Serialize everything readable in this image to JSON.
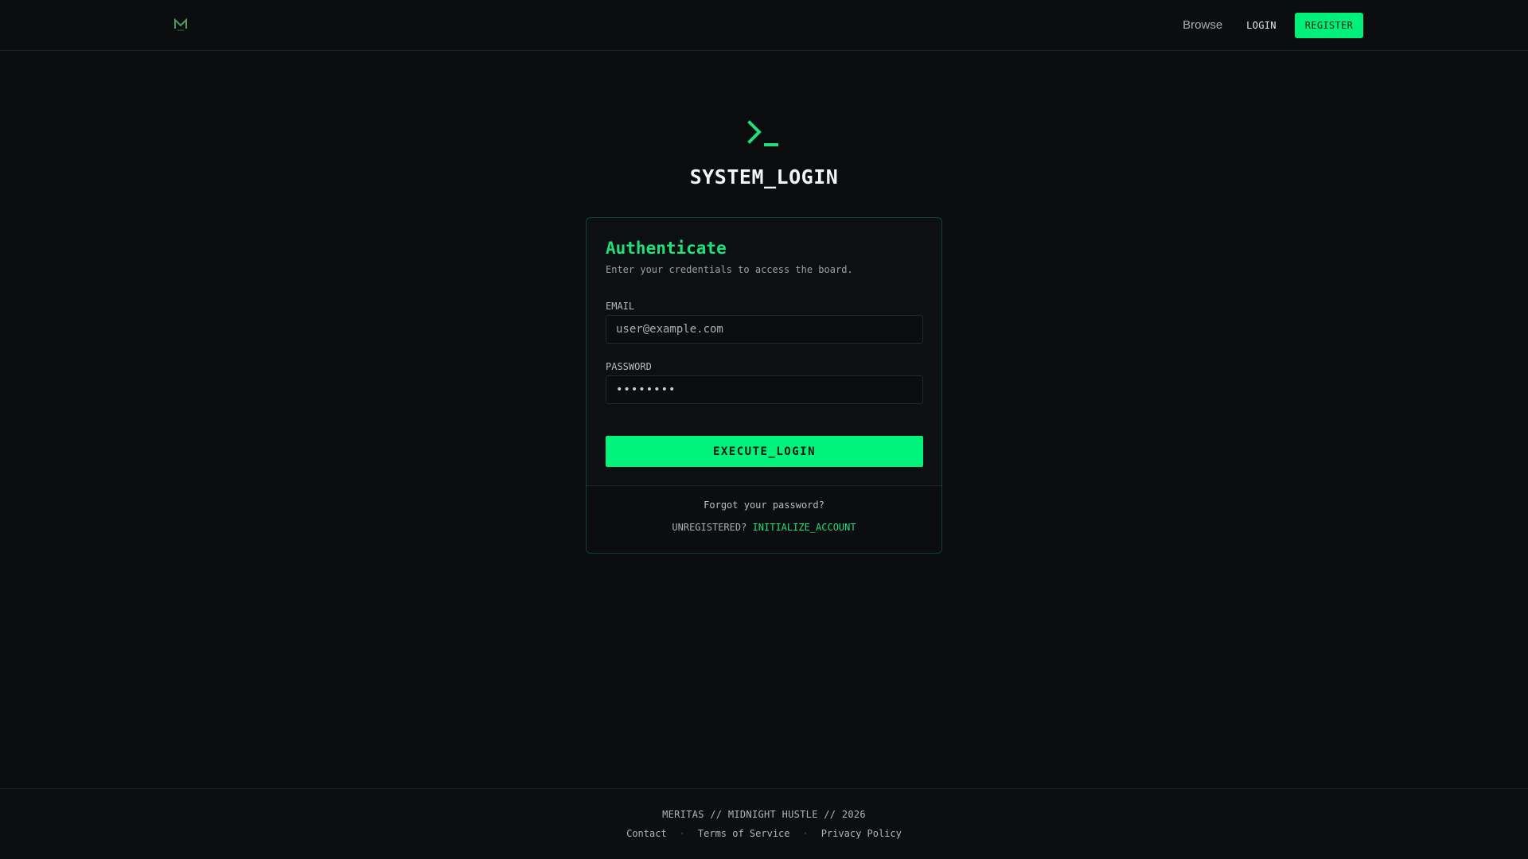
{
  "colors": {
    "accent": "#00f07a",
    "background": "#0a0c0e",
    "heading_accent": "#1fe07a"
  },
  "navbar": {
    "logo_icon": "m-logo-icon",
    "browse_label": "Browse",
    "login_label": "LOGIN",
    "register_label": "REGISTER"
  },
  "hero": {
    "icon": "terminal-prompt-icon",
    "title": "SYSTEM_LOGIN"
  },
  "card": {
    "title": "Authenticate",
    "subtitle": "Enter your credentials to access the board.",
    "email_label": "EMAIL",
    "email_placeholder": "user@example.com",
    "password_label": "PASSWORD",
    "password_value": "••••••••",
    "submit_label": "EXECUTE_LOGIN",
    "forgot_label": "Forgot your password?",
    "unregistered_label": "UNREGISTERED?",
    "init_account_label": "INITIALIZE_ACCOUNT"
  },
  "footer": {
    "copyright": "MERITAS // MIDNIGHT HUSTLE // 2026",
    "links": [
      "Contact",
      "Terms of Service",
      "Privacy Policy"
    ],
    "separator": "·"
  }
}
